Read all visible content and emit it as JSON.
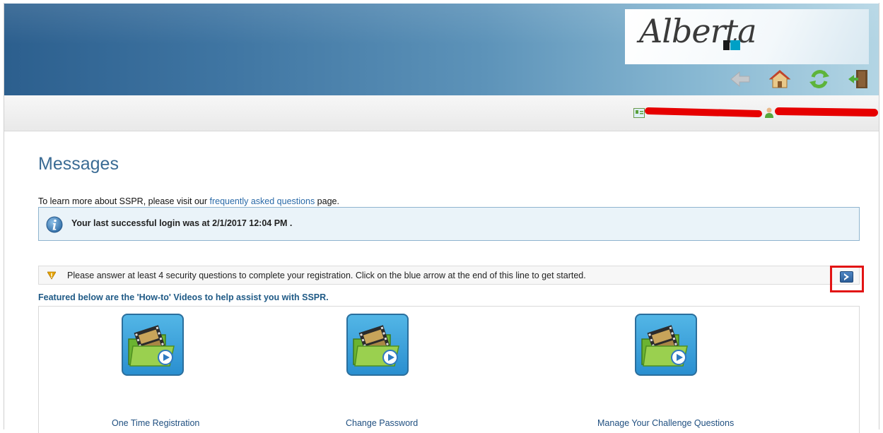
{
  "header": {
    "logo_text": "Alberta",
    "toolbar": {
      "back_icon": "back-arrow-icon",
      "home_icon": "home-icon",
      "refresh_icon": "refresh-icon",
      "logout_icon": "logout-door-icon"
    }
  },
  "userbar": {
    "profile_icon": "profile-card-icon",
    "user_icon": "user-icon"
  },
  "main": {
    "title": "Messages",
    "faq": {
      "prefix": "To learn more about SSPR, please visit our ",
      "link": "frequently asked questions",
      "suffix": " page."
    },
    "info": {
      "text": "Your last successful login was at 2/1/2017 12:04 PM ."
    },
    "warning": {
      "text": "Please answer at least 4 security questions to complete your registration. Click on the blue arrow at the end of this line to get started."
    },
    "featured_heading": "Featured below are the 'How-to' Videos to help assist you with SSPR.",
    "videos": [
      {
        "label": "One Time Registration"
      },
      {
        "label": "Change Password"
      },
      {
        "label": "Manage Your Challenge Questions"
      }
    ]
  },
  "colors": {
    "title": "#3a6b94",
    "link": "#2a6aa8",
    "info_bg": "#eaf3f9",
    "highlight": "#e21414"
  }
}
